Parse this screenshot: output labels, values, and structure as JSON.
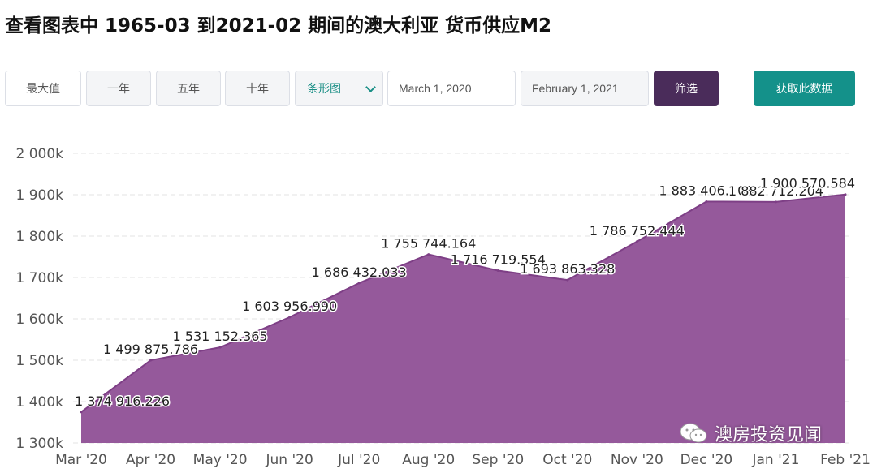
{
  "title": "查看图表中 1965-03 到2021-02 期间的澳大利亚 货币供应M2",
  "controls": {
    "btn_max": "最大值",
    "btn_1y": "一年",
    "btn_5y": "五年",
    "btn_10y": "十年",
    "chart_type_select": "条形图",
    "date_from": "March 1, 2020",
    "date_to": "February 1, 2021",
    "filter_button": "筛选",
    "get_data_button": "获取此数据"
  },
  "colors": {
    "area_fill": "#95599b",
    "area_stroke": "#7e3f86",
    "filter_bg": "#4a2c5a",
    "get_data_bg": "#14918a"
  },
  "watermark": {
    "icon": "wechat-icon",
    "text": "澳房投资见闻"
  },
  "chart_data": {
    "type": "area",
    "categories": [
      "Mar '20",
      "Apr '20",
      "May '20",
      "Jun '20",
      "Jul '20",
      "Aug '20",
      "Sep '20",
      "Oct '20",
      "Nov '20",
      "Dec '20",
      "Jan '21",
      "Feb '21"
    ],
    "values": [
      1374916.226,
      1499875.786,
      1531152.365,
      1603956.99,
      1686432.033,
      1755744.164,
      1716719.554,
      1693863.328,
      1786752.444,
      1883406.108,
      1882712.204,
      1900570.584
    ],
    "value_labels": [
      "1 374 916.226",
      "1 499 875.786",
      "1 531 152.365",
      "1 603 956.990",
      "1 686 432.033",
      "1 755 744.164",
      "1 716 719.554",
      "1 693 863.328",
      "1 786 752.444",
      "1 883 406.108",
      "1 882 712.204",
      "1 900 570.584"
    ],
    "ylim": [
      1300000,
      2000000
    ],
    "yticks": [
      1300000,
      1400000,
      1500000,
      1600000,
      1700000,
      1800000,
      1900000,
      2000000
    ],
    "ytick_labels": [
      "1 300k",
      "1 400k",
      "1 500k",
      "1 600k",
      "1 700k",
      "1 800k",
      "1 900k",
      "2 000k"
    ],
    "grid": true,
    "xlabel": "",
    "ylabel": ""
  }
}
